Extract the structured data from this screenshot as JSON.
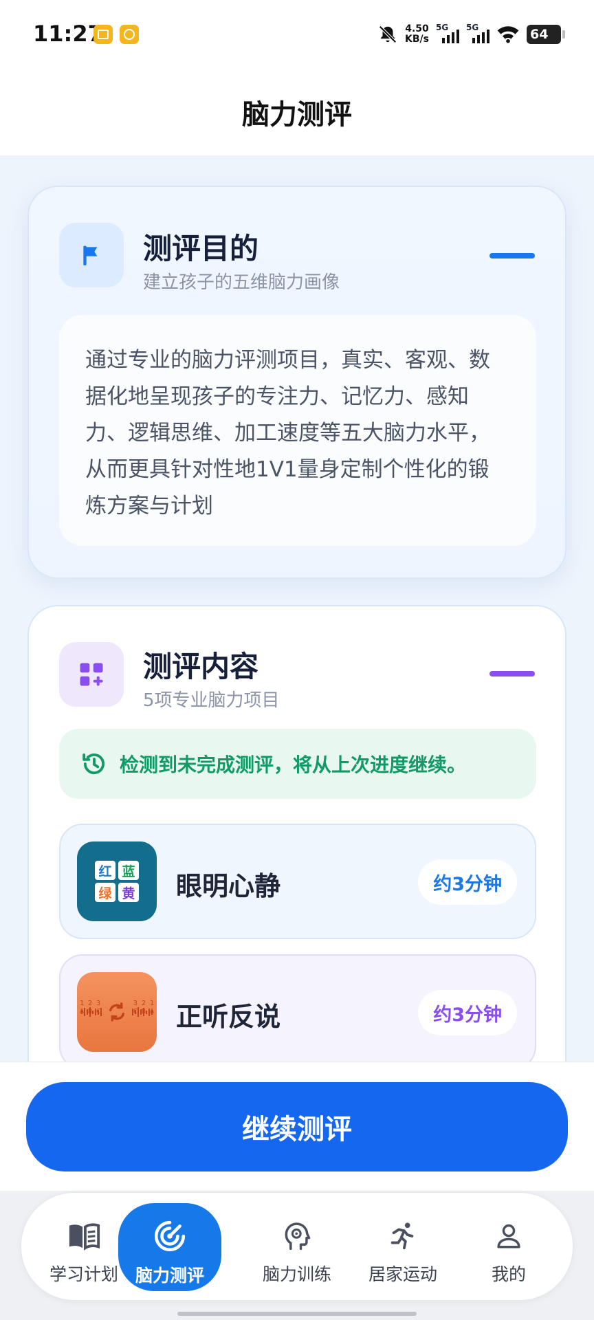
{
  "status_bar": {
    "time": "11:27",
    "net_speed_value": "4.50",
    "net_speed_unit": "KB/s",
    "signal1_label": "5G",
    "signal2_label": "5G",
    "battery": "64",
    "icons": [
      "mail-notification-icon",
      "coin-notification-icon",
      "bell-muted-icon",
      "signal-icon",
      "signal-icon",
      "wifi-icon",
      "battery-icon"
    ]
  },
  "header": {
    "title": "脑力测评"
  },
  "purpose": {
    "title": "测评目的",
    "subtitle": "建立孩子的五维脑力画像",
    "icon": "flag-icon",
    "accent": "#1677f0",
    "description": "通过专业的脑力评测项目，真实、客观、数据化地呈现孩子的专注力、记忆力、感知力、逻辑思维、加工速度等五大脑力水平，从而更具针对性地1V1量身定制个性化的锻炼方案与计划"
  },
  "content": {
    "title": "测评内容",
    "subtitle": "5项专业脑力项目",
    "icon": "apps-add-icon",
    "accent": "#8a4ef0",
    "notice": "检测到未完成测评，将从上次进度继续。",
    "notice_icon": "history-icon",
    "items": [
      {
        "name": "眼明心静",
        "duration": "约3分钟",
        "thumb_chars": [
          "红",
          "蓝",
          "绿",
          "黄"
        ]
      },
      {
        "name": "正听反说",
        "duration": "约3分钟",
        "thumb_text_left": "1 2 3\nA B C",
        "thumb_text_right": "3 2 1\nC B A"
      }
    ]
  },
  "cta": {
    "label": "继续测评"
  },
  "nav": {
    "items": [
      {
        "label": "学习计划",
        "icon": "book-icon",
        "active": false
      },
      {
        "label": "脑力测评",
        "icon": "radar-icon",
        "active": true
      },
      {
        "label": "脑力训练",
        "icon": "brain-head-icon",
        "active": false
      },
      {
        "label": "居家运动",
        "icon": "running-icon",
        "active": false
      },
      {
        "label": "我的",
        "icon": "user-icon",
        "active": false
      }
    ]
  }
}
